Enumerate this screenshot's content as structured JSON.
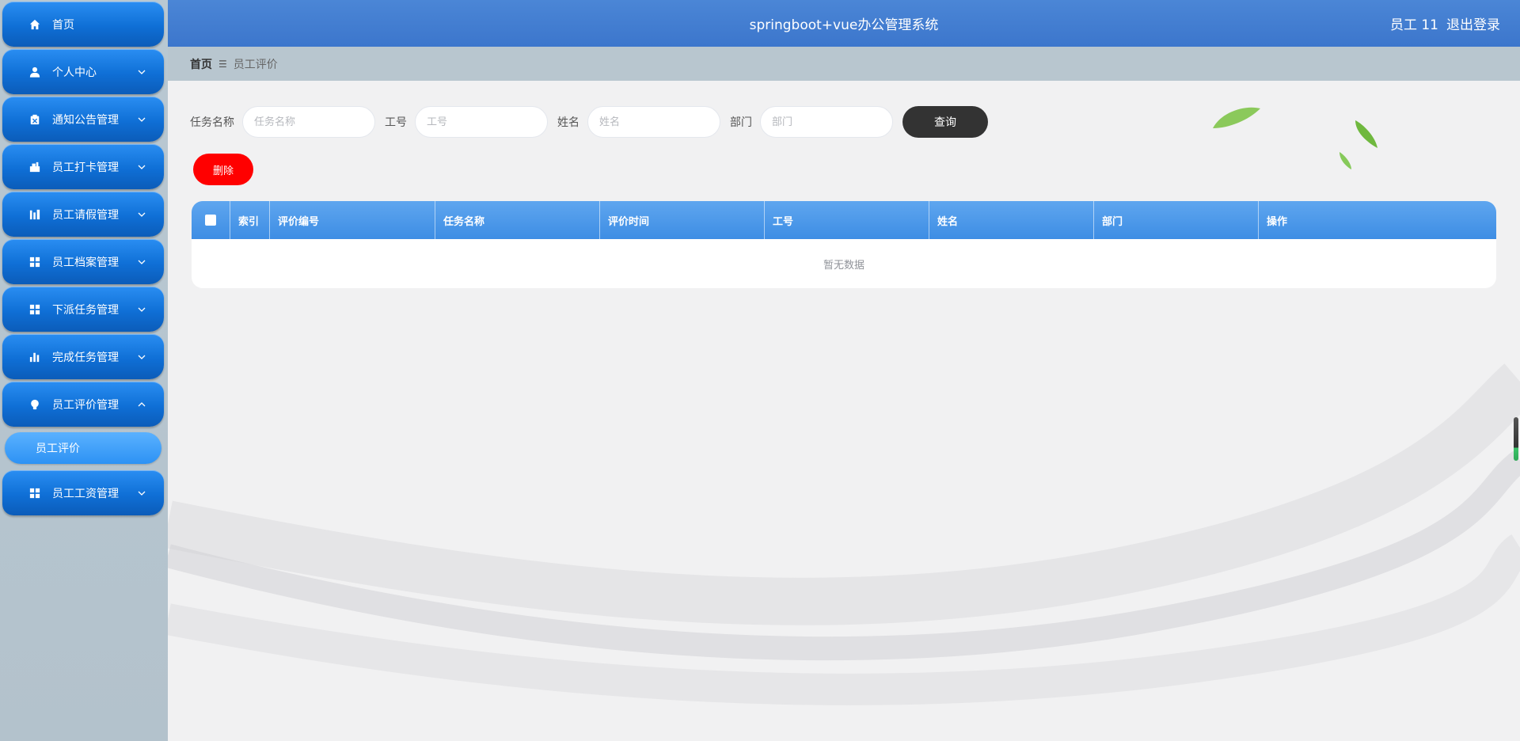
{
  "header": {
    "title": "springboot+vue办公管理系统",
    "user_label": "员工 11",
    "logout_label": "退出登录"
  },
  "sidebar": {
    "items": [
      {
        "label": "首页",
        "icon": "home-icon",
        "expandable": false
      },
      {
        "label": "个人中心",
        "icon": "user-icon",
        "expandable": true
      },
      {
        "label": "通知公告管理",
        "icon": "notice-icon",
        "expandable": true
      },
      {
        "label": "员工打卡管理",
        "icon": "punch-icon",
        "expandable": true
      },
      {
        "label": "员工请假管理",
        "icon": "leave-icon",
        "expandable": true
      },
      {
        "label": "员工档案管理",
        "icon": "grid-icon",
        "expandable": true
      },
      {
        "label": "下派任务管理",
        "icon": "grid-icon",
        "expandable": true
      },
      {
        "label": "完成任务管理",
        "icon": "bar-chart-icon",
        "expandable": true
      },
      {
        "label": "员工评价管理",
        "icon": "bulb-icon",
        "expandable": true,
        "expanded": true
      },
      {
        "label": "员工工资管理",
        "icon": "grid-icon",
        "expandable": true
      }
    ],
    "submenu": {
      "label": "员工评价"
    }
  },
  "breadcrumb": {
    "home": "首页",
    "current": "员工评价"
  },
  "search": {
    "fields": [
      {
        "label": "任务名称",
        "placeholder": "任务名称"
      },
      {
        "label": "工号",
        "placeholder": "工号"
      },
      {
        "label": "姓名",
        "placeholder": "姓名"
      },
      {
        "label": "部门",
        "placeholder": "部门"
      }
    ],
    "query_label": "查询"
  },
  "actions": {
    "delete_label": "删除"
  },
  "table": {
    "columns": [
      "索引",
      "评价编号",
      "任务名称",
      "评价时间",
      "工号",
      "姓名",
      "部门",
      "操作"
    ],
    "empty_text": "暂无数据"
  },
  "colors": {
    "header_blue": "#4b86d6",
    "menu_blue": "#0f6fd6",
    "delete_red": "#ff0000",
    "query_dark": "#333333",
    "table_header": "#3d8de4"
  }
}
